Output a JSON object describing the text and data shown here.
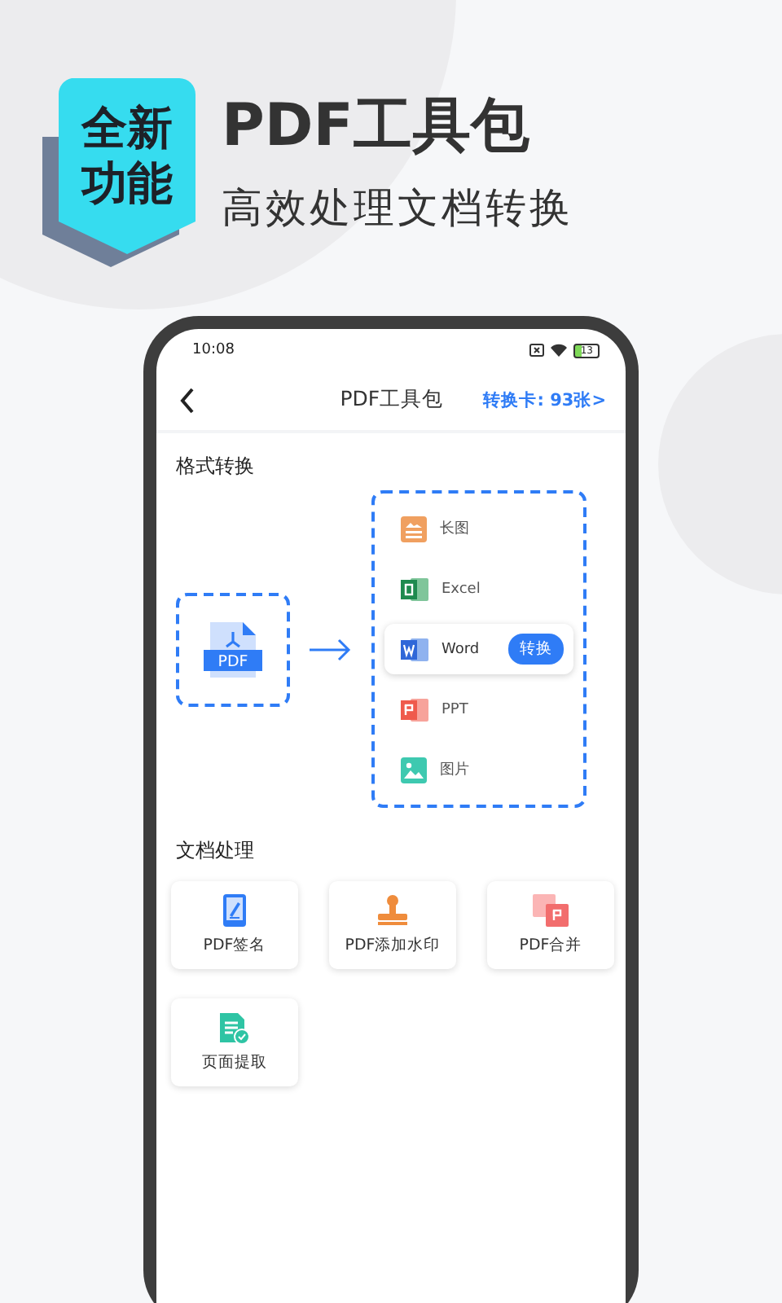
{
  "badge": {
    "label": "全新功能"
  },
  "headline": {
    "title": "PDF工具包",
    "subtitle": "高效处理文档转换"
  },
  "phone": {
    "status_bar": {
      "time": "10:08",
      "battery": "13"
    },
    "nav": {
      "title": "PDF工具包",
      "card_link": "转换卡: 93张>"
    },
    "convert": {
      "title": "格式转换",
      "source": "PDF",
      "action": "转换",
      "targets": [
        {
          "kind": "long-image",
          "label": "长图",
          "selected": false
        },
        {
          "kind": "excel",
          "label": "Excel",
          "selected": false
        },
        {
          "kind": "word",
          "label": "Word",
          "selected": true
        },
        {
          "kind": "ppt",
          "label": "PPT",
          "selected": false
        },
        {
          "kind": "image",
          "label": "图片",
          "selected": false
        }
      ]
    },
    "tools": {
      "title": "文档处理",
      "items": [
        {
          "kind": "sign",
          "label": "PDF签名"
        },
        {
          "kind": "watermark",
          "label": "PDF添加水印"
        },
        {
          "kind": "merge",
          "label": "PDF合并"
        },
        {
          "kind": "extract",
          "label": "页面提取"
        }
      ]
    }
  }
}
